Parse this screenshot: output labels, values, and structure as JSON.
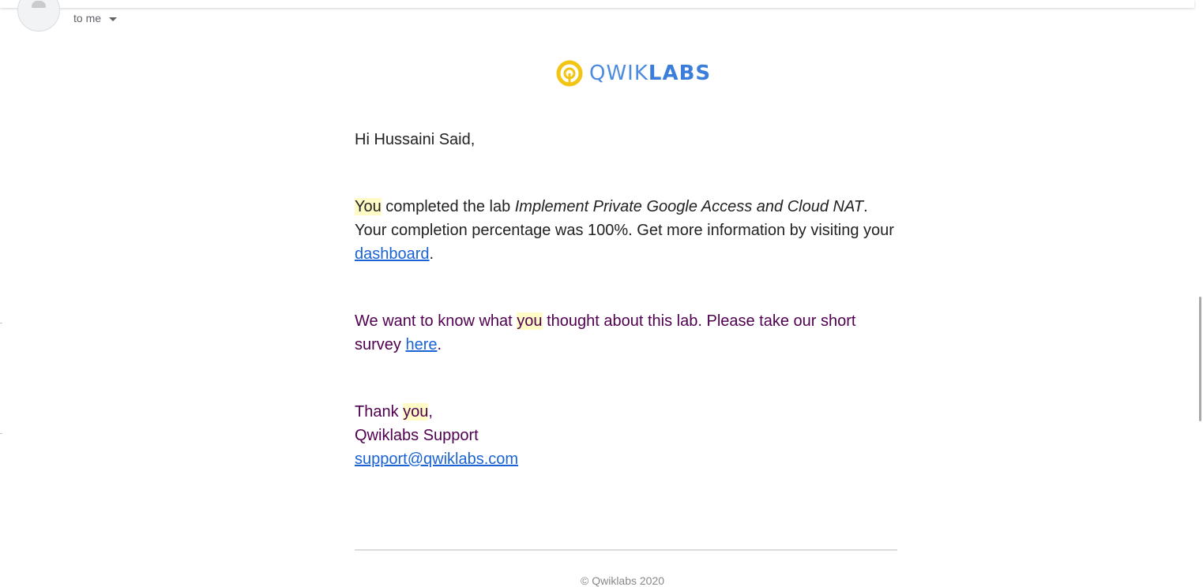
{
  "header": {
    "recipient_label": "to me",
    "avatar_icon": "person-icon"
  },
  "logo": {
    "text_light": "QWIK",
    "text_bold": "LABS",
    "icon": "qwiklabs-logo-icon",
    "colors": {
      "ring": "#f2c514",
      "text": "#4c8be0"
    }
  },
  "email": {
    "greeting": "Hi Hussaini Said,",
    "completed": {
      "you": "You",
      "pre_lab": " completed the lab ",
      "lab_name": "Implement Private Google Access and Cloud NAT",
      "post_lab": ". Your completion percentage was 100%. Get more information by visiting your ",
      "dashboard_link": "dashboard",
      "end": "."
    },
    "survey": {
      "pre": "We want to know what ",
      "you": "you",
      "mid": " thought about this lab. Please take our short survey ",
      "here_link": "here",
      "end": "."
    },
    "signoff": {
      "thank": "Thank ",
      "you": "you",
      "comma": ",",
      "team": "Qwiklabs Support",
      "email_link": "support@qwiklabs.com"
    },
    "footer": "© Qwiklabs 2020"
  },
  "colors": {
    "link": "#1a63d4",
    "highlight": "#fffbc7",
    "quoted_text": "#500050"
  }
}
